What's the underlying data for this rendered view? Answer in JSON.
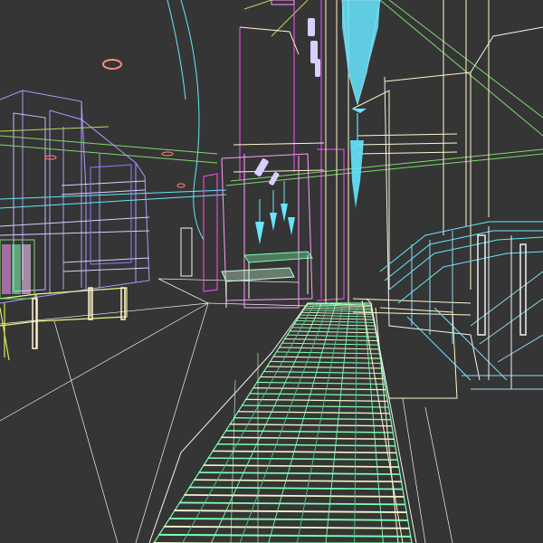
{
  "viewport": {
    "background": "#353535",
    "render_mode": "wireframe"
  },
  "palette": {
    "walkway": "#7dffb0",
    "walkway_dim": "#52c98a",
    "stair": "#eef7c8",
    "magenta": "#ff4dff",
    "pink": "#ff9cff",
    "cyan": "#66e6ff",
    "cyan_soft": "#8fd9f0",
    "lavender": "#a99cff",
    "lavender_light": "#d8cfff",
    "yellow": "#f2f08a",
    "cream": "#fff6cf",
    "white": "#f2f2f2",
    "green": "#7dd96b",
    "olive": "#b9d85a",
    "salmon": "#ff8a80"
  }
}
